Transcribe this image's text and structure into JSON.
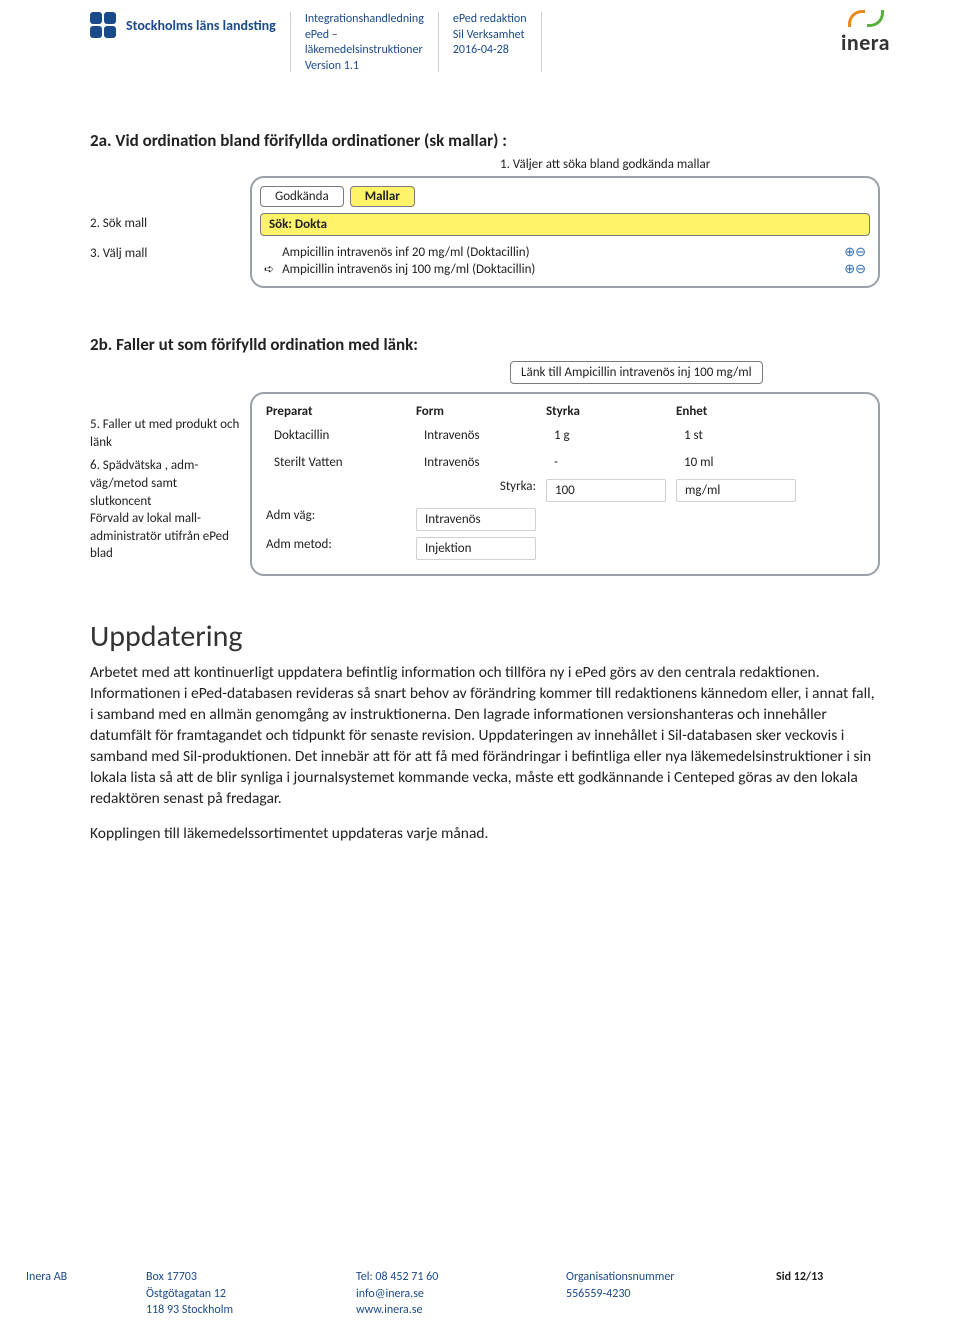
{
  "header": {
    "org": "Stockholms läns landsting",
    "doc_line1": "Integrationshandledning",
    "doc_line2": "ePed –",
    "doc_line3": "läkemedelsinstruktioner",
    "doc_line4": "Version 1.1",
    "owner_line1": "ePed redaktion",
    "owner_line2": "Sil Verksamhet",
    "owner_date": "2016-04-28",
    "brand": "inera"
  },
  "sec2a": {
    "title": "2a. Vid ordination bland förifyllda ordinationer (sk mallar) :",
    "step1": "1. Väljer att söka bland godkända mallar",
    "step2": "2. Sök  mall",
    "step3": "3. Välj mall",
    "tab_godkanda": "Godkända",
    "tab_mallar": "Mallar",
    "search_prefix": "Sök:",
    "search_value": "Dokta",
    "result1": "Ampicillin intravenös inf  20 mg/ml (Doktacillin)",
    "result2": "Ampicillin intravenös inj 100 mg/ml (Doktacillin)"
  },
  "sec2b": {
    "title": "2b. Faller ut som förifylld ordination med länk:",
    "linktext": "Länk till Ampicillin intravenös inj 100 mg/ml",
    "side": {
      "s5": "5. Faller ut med produkt och länk",
      "s6": "6. Spädvätska , adm-väg/metod samt slutkoncent\nFörvald av lokal mall-administratör utifrån ePed blad"
    },
    "cols": {
      "preparat": "Preparat",
      "form": "Form",
      "styrka": "Styrka",
      "enhet": "Enhet"
    },
    "row1": {
      "preparat": "Doktacillin",
      "form": "Intravenös",
      "styrka": "1 g",
      "enhet": "1 st"
    },
    "row2": {
      "preparat": "Sterilt Vatten",
      "form": "Intravenös",
      "styrka": "-",
      "enhet": "10 ml"
    },
    "styrka_lbl": "Styrka:",
    "styrka_val": "100",
    "styrka_unit": "mg/ml",
    "admvag_lbl": "Adm väg:",
    "admvag_val": "Intravenös",
    "admmet_lbl": "Adm metod:",
    "admmet_val": "Injektion"
  },
  "body": {
    "heading": "Uppdatering",
    "p1": "Arbetet med att kontinuerligt uppdatera befintlig information och tillföra ny i ePed görs av den centrala redaktionen. Informationen i ePed-databasen revideras så snart behov av förändring kommer till redaktionens kännedom eller, i annat fall, i samband med en allmän genomgång av instruktionerna. Den lagrade informationen versionshanteras och innehåller datumfält för framtagandet och tidpunkt för senaste revision. Uppdateringen av innehållet i Sil-databasen sker veckovis i samband med Sil-produktionen. Det innebär att för att få med förändringar i befintliga eller nya läkemedelsinstruktioner i sin lokala lista så att de blir synliga i journalsystemet kommande vecka, måste ett godkännande i Centeped göras av den lokala redaktören senast på fredagar.",
    "p2": "Kopplingen till läkemedelssortimentet uppdateras varje månad."
  },
  "footer": {
    "company": "Inera AB",
    "addr1": "Box 17703",
    "addr2": "Östgötagatan 12",
    "addr3": "118 93 Stockholm",
    "tel": "Tel: 08 452 71 60",
    "email": "info@inera.se",
    "web": "www.inera.se",
    "orgnr_lbl": "Organisationsnummer",
    "orgnr": "556559-4230",
    "page": "Sid 12/13"
  }
}
